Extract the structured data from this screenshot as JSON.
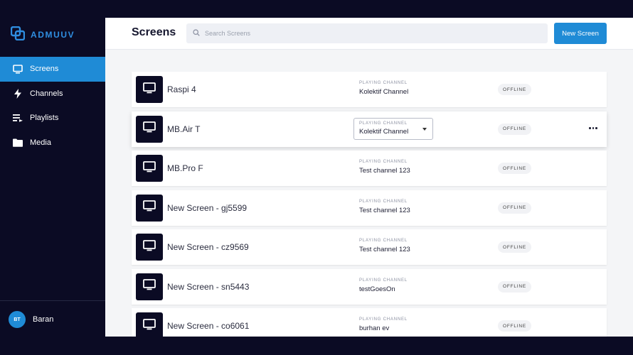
{
  "app": {
    "brand": "ADMUUV"
  },
  "sidebar": {
    "items": [
      {
        "label": "Screens",
        "icon": "monitor-icon",
        "active": true
      },
      {
        "label": "Channels",
        "icon": "lightning-icon",
        "active": false
      },
      {
        "label": "Playlists",
        "icon": "playlist-icon",
        "active": false
      },
      {
        "label": "Media",
        "icon": "folder-icon",
        "active": false
      }
    ],
    "user": {
      "initials": "BT",
      "name": "Baran"
    }
  },
  "header": {
    "title": "Screens",
    "search_placeholder": "Search Screens",
    "new_button": "New Screen"
  },
  "screens": [
    {
      "name": "Raspi 4",
      "channel_label": "PLAYING CHANNEL",
      "channel": "Kolektif Channel",
      "status": "OFFLINE"
    },
    {
      "name": "MB.Air T",
      "channel_label": "PLAYING CHANNEL",
      "channel": "Kolektif Channel",
      "status": "OFFLINE",
      "hovered": true
    },
    {
      "name": "MB.Pro F",
      "channel_label": "PLAYING CHANNEL",
      "channel": "Test channel 123",
      "status": "OFFLINE"
    },
    {
      "name": "New Screen - gj5599",
      "channel_label": "PLAYING CHANNEL",
      "channel": "Test channel 123",
      "status": "OFFLINE"
    },
    {
      "name": "New Screen - cz9569",
      "channel_label": "PLAYING CHANNEL",
      "channel": "Test channel 123",
      "status": "OFFLINE"
    },
    {
      "name": "New Screen - sn5443",
      "channel_label": "PLAYING CHANNEL",
      "channel": "testGoesOn",
      "status": "OFFLINE"
    },
    {
      "name": "New Screen - co6061",
      "channel_label": "PLAYING CHANNEL",
      "channel": "burhan ev",
      "status": "OFFLINE"
    }
  ],
  "colors": {
    "accent": "#1f8bd6",
    "sidebar_bg": "#0b0b24",
    "brand": "#2f8ee0"
  }
}
